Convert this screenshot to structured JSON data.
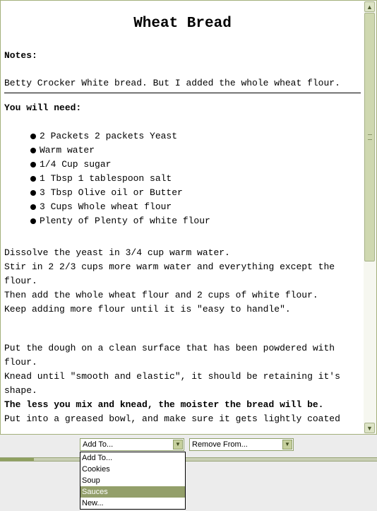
{
  "recipe": {
    "title": "Wheat Bread",
    "notes_label": "Notes:",
    "notes_text": "Betty Crocker White bread. But I added the whole wheat flour.",
    "need_label": "You will need:",
    "ingredients": [
      "2 Packets 2 packets Yeast",
      "Warm water",
      "1/4 Cup sugar",
      "1 Tbsp 1 tablespoon salt",
      "3 Tbsp Olive oil or Butter",
      "3 Cups Whole wheat flour",
      "Plenty of Plenty of white flour"
    ],
    "steps_a": [
      "Dissolve the yeast in 3/4 cup warm water.",
      "Stir in 2 2/3 cups more warm water and everything except the",
      "flour.",
      "Then add the whole wheat flour and 2 cups of white flour.",
      "Keep adding more flour until it is \"easy to handle\"."
    ],
    "steps_b": [
      "Put the dough on a clean surface that has been powdered with",
      "flour.",
      "Knead until \"smooth and elastic\", it should be retaining it's",
      "shape."
    ],
    "bold_step": "The less you mix and knead, the moister the bread will be.",
    "last_step": "Put into a greased bowl, and make sure it gets lightly coated"
  },
  "controls": {
    "add_to_value": "Add To...",
    "remove_from_value": "Remove From...",
    "dropdown_options": [
      "Add To...",
      "Cookies",
      "Soup",
      "Sauces",
      "New..."
    ],
    "selected_index": 3
  },
  "colors": {
    "accent": "#939f6a",
    "scroll": "#cfd8b0"
  }
}
